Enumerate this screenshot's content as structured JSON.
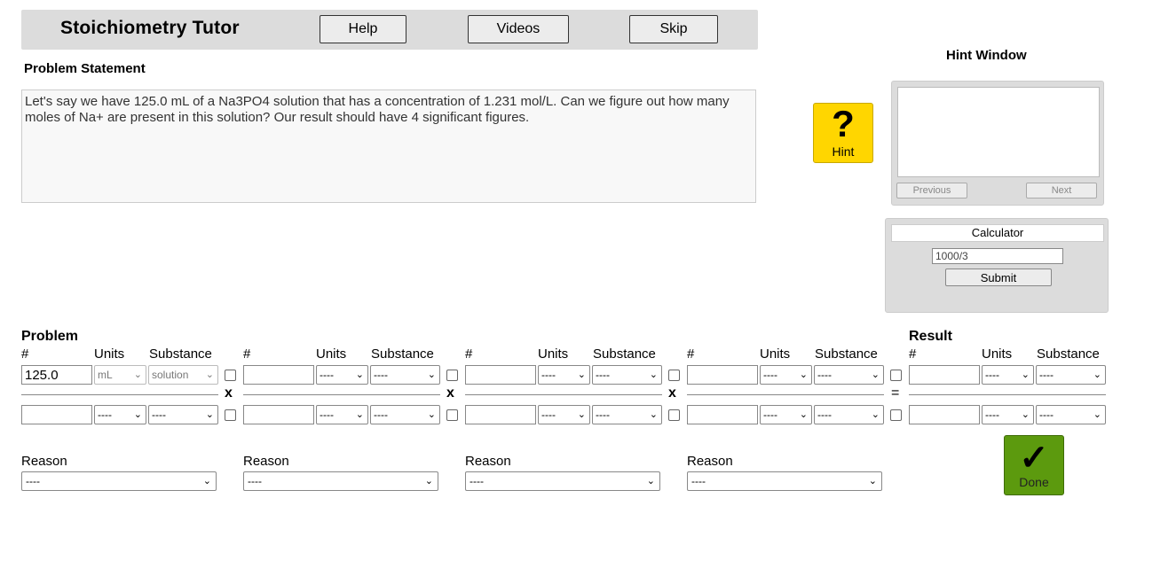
{
  "header": {
    "title": "Stoichiometry Tutor",
    "help_label": "Help",
    "videos_label": "Videos",
    "skip_label": "Skip"
  },
  "problem": {
    "label": "Problem Statement",
    "text": "Let's say we have 125.0 mL of a Na3PO4 solution that has a concentration of 1.231 mol/L.  Can we figure out how many moles of Na+ are present in this solution?  Our result should have 4 significant figures."
  },
  "hint": {
    "window_title": "Hint Window",
    "button_symbol": "?",
    "button_label": "Hint",
    "previous_label": "Previous",
    "next_label": "Next"
  },
  "calculator": {
    "title": "Calculator",
    "input_value": "1000/3",
    "submit_label": "Submit"
  },
  "grid": {
    "problem_title": "Problem",
    "result_title": "Result",
    "col_num": "#",
    "col_units": "Units",
    "col_substance": "Substance",
    "given_value": "125.0",
    "given_units": "mL",
    "given_substance": "solution",
    "placeholder": "----",
    "chevron": "⌄",
    "operator_x": "x",
    "operator_eq": "="
  },
  "reasons": {
    "label": "Reason",
    "value": "----"
  },
  "done": {
    "symbol": "✓",
    "label": "Done"
  }
}
